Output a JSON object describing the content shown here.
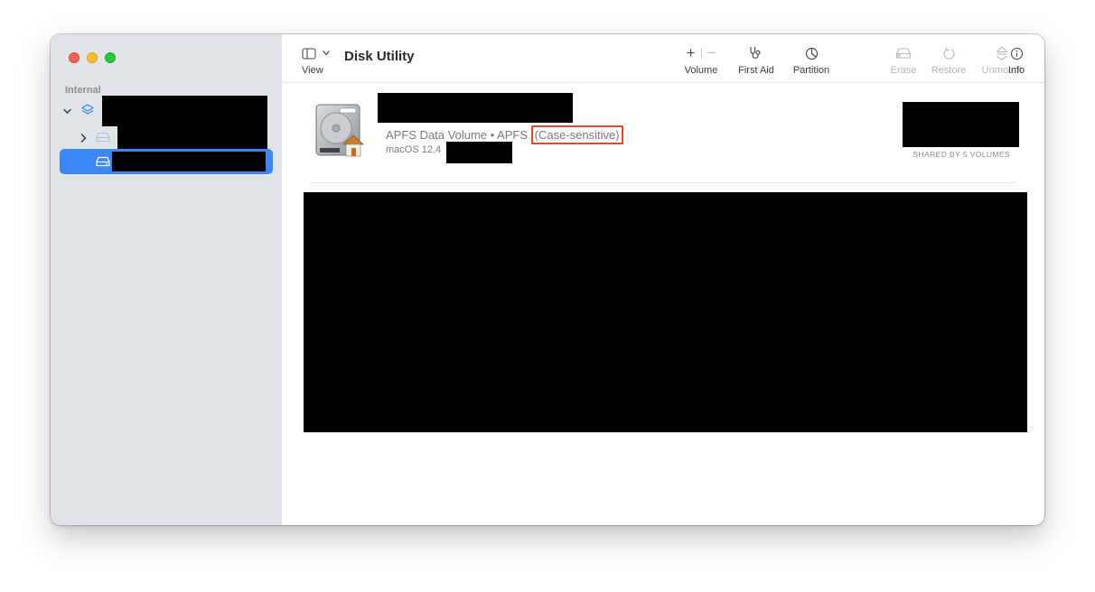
{
  "window": {
    "title": "Disk Utility"
  },
  "sidebar": {
    "section_label": "Internal",
    "items": [
      {
        "type": "container",
        "expanded": true,
        "icon": "layers-icon"
      },
      {
        "type": "disk",
        "expanded": false,
        "icon": "drive-icon"
      },
      {
        "type": "volume",
        "selected": true,
        "icon": "drive-icon"
      }
    ]
  },
  "toolbar": {
    "view_label": "View",
    "volume_label": "Volume",
    "first_aid_label": "First Aid",
    "partition_label": "Partition",
    "erase_label": "Erase",
    "restore_label": "Restore",
    "unmount_label": "Unmount",
    "info_label": "Info"
  },
  "volume": {
    "fs_prefix": "APFS Data Volume • APFS",
    "case_label": "(Case-sensitive)",
    "os_version": "macOS 12.4",
    "shared_label": "SHARED BY 5 VOLUMES"
  },
  "colors": {
    "sidebar_bg": "#dfe4e6",
    "selection": "#3b87f6",
    "highlight_box": "#e8452c",
    "close": "#fe5f57",
    "minimize": "#febc2e",
    "zoom": "#28c840"
  }
}
